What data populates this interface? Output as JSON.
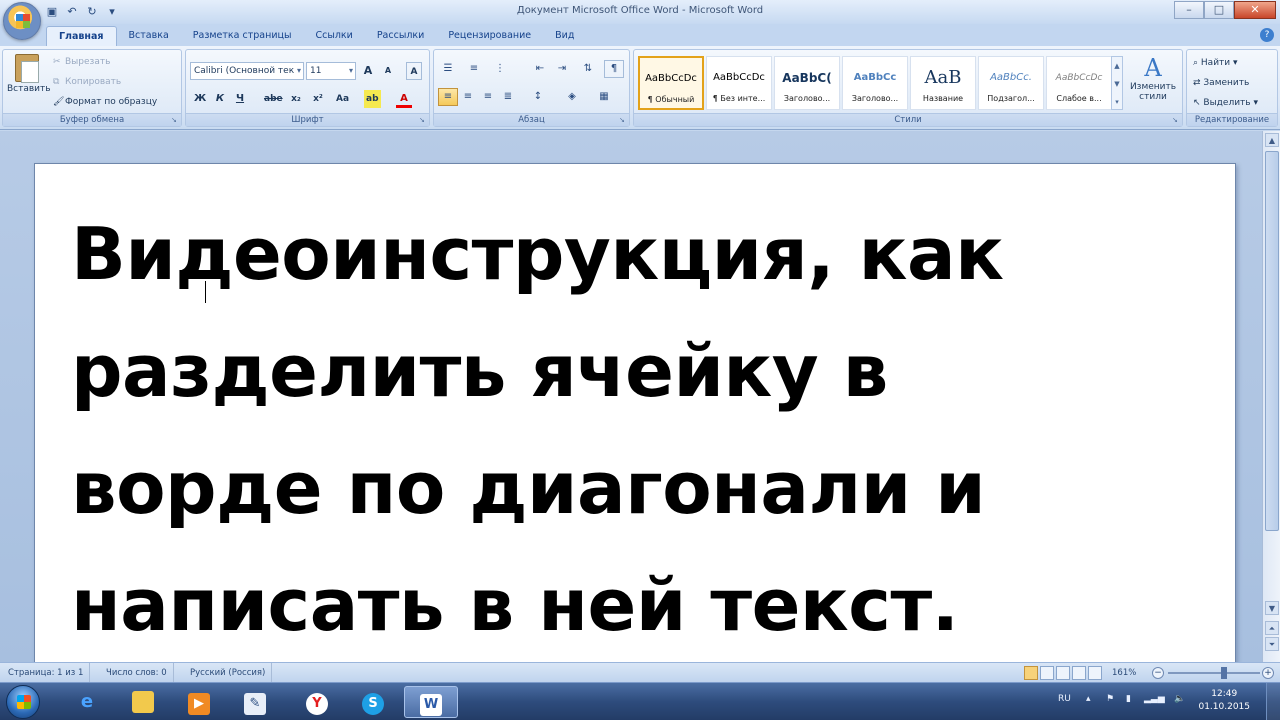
{
  "window": {
    "title": "Документ Microsoft Office Word - Microsoft Word",
    "controls": [
      "–",
      "□",
      "✕"
    ]
  },
  "tabs": [
    "Главная",
    "Вставка",
    "Разметка страницы",
    "Ссылки",
    "Рассылки",
    "Рецензирование",
    "Вид"
  ],
  "ribbon": {
    "clipboard": {
      "label": "Буфер обмена",
      "paste": "Вставить",
      "cut": "Вырезать",
      "copy": "Копировать",
      "format_painter": "Формат по образцу"
    },
    "font": {
      "label": "Шрифт",
      "font_name": "Calibri (Основной тек",
      "font_size": "11",
      "grow": "A",
      "shrink": "A",
      "clear": "A",
      "bold": "Ж",
      "italic": "К",
      "underline": "Ч",
      "strike": "abe",
      "subscript": "x₂",
      "superscript": "x²",
      "case": "Аа",
      "highlight": "ab",
      "color": "A"
    },
    "paragraph": {
      "label": "Абзац"
    },
    "styles": {
      "label": "Стили",
      "items": [
        {
          "sample": "AaBbCcDc",
          "name": "¶ Обычный"
        },
        {
          "sample": "AaBbCcDc",
          "name": "¶ Без инте..."
        },
        {
          "sample": "AaBbC(",
          "name": "Заголово..."
        },
        {
          "sample": "AaBbCc",
          "name": "Заголово..."
        },
        {
          "sample": "AaB",
          "name": "Название"
        },
        {
          "sample": "AaBbCc.",
          "name": "Подзагол..."
        },
        {
          "sample": "AaBbCcDc",
          "name": "Слабое в..."
        }
      ],
      "change_styles": "Изменить стили"
    },
    "editing": {
      "label": "Редактирование",
      "find": "Найти",
      "replace": "Заменить",
      "select": "Выделить"
    }
  },
  "document": {
    "lines": [
      "Видеоинструкция, как",
      "разделить ячейку в",
      "ворде по диагонали и",
      "написать в ней текст."
    ]
  },
  "statusbar": {
    "page": "Страница: 1 из 1",
    "words": "Число слов: 0",
    "language": "Русский (Россия)",
    "zoom": "161%",
    "zoom_level": 0.61
  },
  "taskbar": {
    "language": "RU",
    "time": "12:49",
    "date": "01.10.2015"
  },
  "colors": {
    "accent": "#15428b",
    "taskbar": "#2e4c7d",
    "active_style": "#e3a21a"
  }
}
